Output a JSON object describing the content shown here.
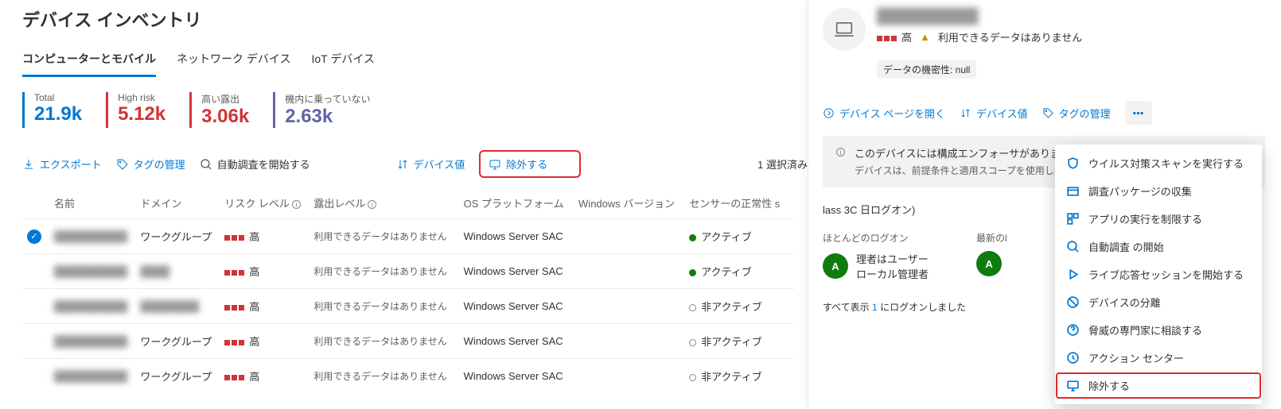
{
  "page_title": "デバイス インベントリ",
  "tabs": [
    "コンピューターとモバイル",
    "ネットワーク デバイス",
    "IoT デバイス"
  ],
  "stats": {
    "total": {
      "label": "Total",
      "value": "21.9k"
    },
    "high_risk": {
      "label": "High risk",
      "value": "5.12k"
    },
    "high_exp": {
      "label": "高い露出",
      "value": "3.06k"
    },
    "not_onboard": {
      "label": "機内に乗っていない",
      "value": "2.63k"
    }
  },
  "toolbar": {
    "export": "エクスポート",
    "tag_manage": "タグの管理",
    "auto_investigate": "自動調査を開始する",
    "device_value": "デバイス値",
    "exclude": "除外する",
    "selected_text": "1 選択済み"
  },
  "columns": {
    "name": "名前",
    "domain": "ドメイン",
    "risk": "リスク レベル",
    "exposure": "露出レベル",
    "platform": "OS プラットフォーム",
    "winver": "Windows バージョン",
    "sensor": "センサーの正常性 s"
  },
  "rows": [
    {
      "name": "██████████",
      "domain": "ワークグループ",
      "risk": "高",
      "exposure": "利用できるデータはありません",
      "platform": "Windows Server SAC",
      "winver": "",
      "sensor": "アクティブ",
      "active": true,
      "selected": true
    },
    {
      "name": "██████████",
      "domain": "████",
      "risk": "高",
      "exposure": "利用できるデータはありません",
      "platform": "Windows Server SAC",
      "winver": "",
      "sensor": "アクティブ",
      "active": true,
      "selected": false
    },
    {
      "name": "██████████",
      "domain": "████████",
      "risk": "高",
      "exposure": "利用できるデータはありません",
      "platform": "Windows Server SAC",
      "winver": "",
      "sensor": "非アクティブ",
      "active": false,
      "selected": false
    },
    {
      "name": "██████████",
      "domain": "ワークグループ",
      "risk": "高",
      "exposure": "利用できるデータはありません",
      "platform": "Windows Server SAC",
      "winver": "",
      "sensor": "非アクティブ",
      "active": false,
      "selected": false
    },
    {
      "name": "██████████",
      "domain": "ワークグループ",
      "risk": "高",
      "exposure": "利用できるデータはありません",
      "platform": "Windows Server SAC",
      "winver": "",
      "sensor": "非アクティブ",
      "active": false,
      "selected": false
    }
  ],
  "panel": {
    "device_name": "██████████",
    "risk_text": "高",
    "exposure_text": "利用できるデータはありません",
    "sensitivity_pill": "データの機密性: null",
    "cmd_open": "デバイス ページを開く",
    "cmd_value": "デバイス値",
    "cmd_tags": "タグの管理",
    "info_title": "このデバイスには構成エンフォーサがあります",
    "info_body": "デバイスは、前提条件と適用スコープを使用して自分を管理MDEに登録されていません。管",
    "last_logon_snippet": "lass 3C 日ログオン)",
    "most_logon_title": "ほとんどのログオン",
    "most_logon_line1": "理者はユーザー",
    "most_logon_line2": "ローカル管理者",
    "latest_logon_title": "最新のl",
    "avatar_initial": "A",
    "show_all_prefix": "すべて表示",
    "show_all_linktext": "1",
    "show_all_suffix": "にログオンしました",
    "menu": [
      "ウイルス対策スキャンを実行する",
      "調査パッケージの収集",
      "アプリの実行を制限する",
      "自動調査 の開始",
      "ライブ応答セッションを開始する",
      "デバイスの分離",
      "脅威の専門家に相談する",
      "アクション センター",
      "除外する"
    ]
  }
}
